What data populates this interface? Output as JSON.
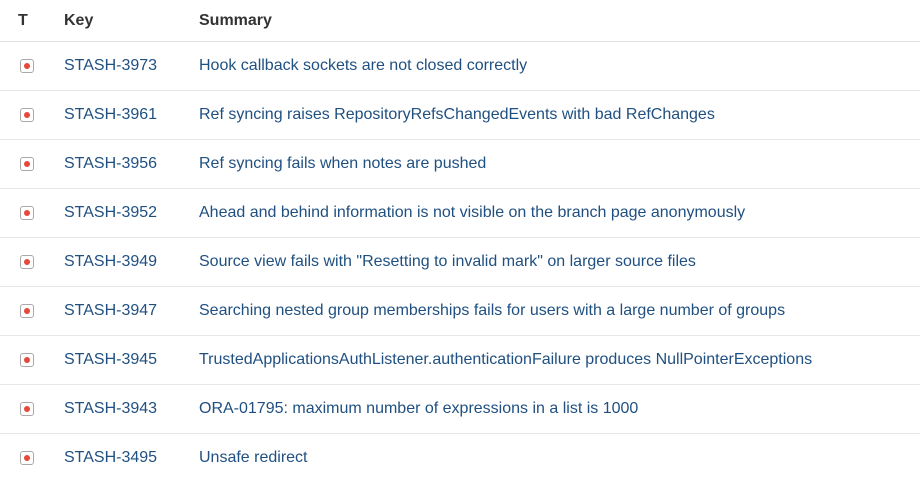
{
  "columns": {
    "type": "T",
    "key": "Key",
    "summary": "Summary"
  },
  "issue_type_icon": "bug-icon",
  "colors": {
    "link": "#205081",
    "bug": "#e5493a"
  },
  "issues": [
    {
      "key": "STASH-3973",
      "summary": "Hook callback sockets are not closed correctly"
    },
    {
      "key": "STASH-3961",
      "summary": "Ref syncing raises RepositoryRefsChangedEvents with bad RefChanges"
    },
    {
      "key": "STASH-3956",
      "summary": "Ref syncing fails when notes are pushed"
    },
    {
      "key": "STASH-3952",
      "summary": "Ahead and behind information is not visible on the branch page anonymously"
    },
    {
      "key": "STASH-3949",
      "summary": "Source view fails with \"Resetting to invalid mark\" on larger source files"
    },
    {
      "key": "STASH-3947",
      "summary": "Searching nested group memberships fails for users with a large number of groups"
    },
    {
      "key": "STASH-3945",
      "summary": "TrustedApplicationsAuthListener.authenticationFailure produces NullPointerExceptions"
    },
    {
      "key": "STASH-3943",
      "summary": "ORA-01795: maximum number of expressions in a list is 1000"
    },
    {
      "key": "STASH-3495",
      "summary": "Unsafe redirect"
    }
  ]
}
